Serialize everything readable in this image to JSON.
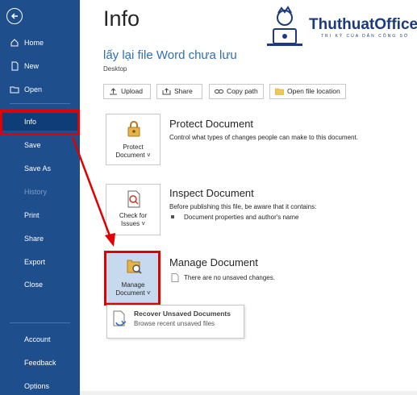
{
  "sidebar": {
    "items": [
      {
        "label": "Home"
      },
      {
        "label": "New"
      },
      {
        "label": "Open"
      },
      {
        "label": "Info"
      },
      {
        "label": "Save"
      },
      {
        "label": "Save As"
      },
      {
        "label": "History"
      },
      {
        "label": "Print"
      },
      {
        "label": "Share"
      },
      {
        "label": "Export"
      },
      {
        "label": "Close"
      },
      {
        "label": "Account"
      },
      {
        "label": "Feedback"
      },
      {
        "label": "Options"
      }
    ]
  },
  "header": {
    "title": "Info",
    "doc_name": "lấy lại file Word chưa lưu",
    "doc_location": "Desktop"
  },
  "toolbar": {
    "upload": "Upload",
    "share": "Share",
    "copy_path": "Copy path",
    "open_location": "Open file location"
  },
  "protect": {
    "tile_line1": "Protect",
    "tile_line2": "Document ˅",
    "title": "Protect Document",
    "desc": "Control what types of changes people can make to this document."
  },
  "inspect": {
    "tile_line1": "Check for",
    "tile_line2": "Issues ˅",
    "title": "Inspect Document",
    "desc": "Before publishing this file, be aware that it contains:",
    "bullet": "Document properties and author's name"
  },
  "manage": {
    "tile_line1": "Manage",
    "tile_line2": "Document ˅",
    "title": "Manage Document",
    "desc": "There are no unsaved changes."
  },
  "recover": {
    "title": "Recover Unsaved Documents",
    "desc": "Browse recent unsaved files"
  },
  "logo": {
    "text": "ThuthuatOffice",
    "sub": "TRI KỶ CỦA DÂN CÔNG SỞ"
  },
  "colors": {
    "sidebar": "#1e4e8c",
    "highlight": "#e00000",
    "link": "#2e6fb8",
    "brand": "#1b3a80"
  }
}
